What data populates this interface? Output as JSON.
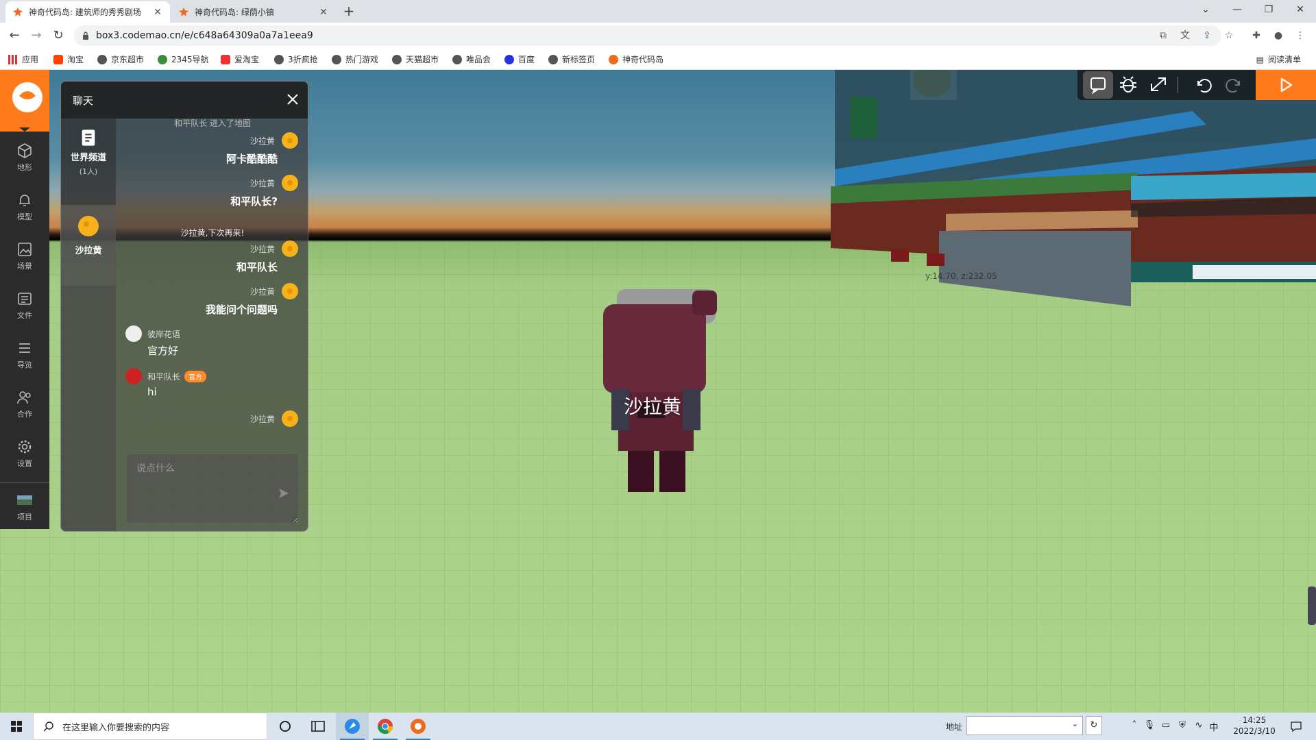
{
  "browser": {
    "tabs": [
      {
        "title": "神奇代码岛: 建筑师的秀秀剧场",
        "close": "✕"
      },
      {
        "title": "神奇代码岛: 绿荫小镇",
        "close": "✕"
      }
    ],
    "new_tab": "+",
    "url": "box3.codemao.cn/e/c648a64309a0a7a1eea9",
    "bookmarks": [
      "应用",
      "淘宝",
      "京东超市",
      "2345导航",
      "爱淘宝",
      "3折疯抢",
      "热门游戏",
      "天猫超市",
      "唯品会",
      "百度",
      "新标签页",
      "神奇代码岛"
    ],
    "reading_list": "阅读清单"
  },
  "sidebar": {
    "items": [
      {
        "label": "地形",
        "icon": "cube-icon"
      },
      {
        "label": "模型",
        "icon": "bell-icon"
      },
      {
        "label": "场景",
        "icon": "image-icon"
      },
      {
        "label": "文件",
        "icon": "file-icon"
      },
      {
        "label": "导览",
        "icon": "list-icon"
      },
      {
        "label": "合作",
        "icon": "users-icon"
      },
      {
        "label": "设置",
        "icon": "gear-icon"
      },
      {
        "label": "项目",
        "icon": "project-thumb"
      }
    ]
  },
  "chat": {
    "title": "聊天",
    "channels": [
      {
        "name": "世界频道",
        "count": "(1人)"
      },
      {
        "name": "沙拉黄"
      }
    ],
    "truncated_top": "和平队长 进入了地图",
    "messages": [
      {
        "author": "沙拉黄",
        "text": "阿卡酷酷酷"
      },
      {
        "author": "沙拉黄",
        "text": "和平队长?"
      },
      {
        "system": "沙拉黄,下次再来!"
      },
      {
        "author": "沙拉黄",
        "text": "和平队长"
      },
      {
        "author": "沙拉黄",
        "text": "我能问个问题吗"
      },
      {
        "author": "彼岸花语",
        "text": "官方好"
      },
      {
        "author": "和平队长",
        "badge": "官方",
        "text": "hi"
      },
      {
        "author": "沙拉黄",
        "text": ""
      }
    ],
    "input_placeholder": "说点什么"
  },
  "game": {
    "player_name": "沙拉黄",
    "coords": "y:14.70, z:232.05"
  },
  "taskbar": {
    "search_placeholder": "在这里输入你要搜索的内容",
    "address_label": "地址",
    "time": "14:25",
    "date": "2022/3/10",
    "ime": "中"
  },
  "colors": {
    "accent": "#ff7a1a",
    "sidebar_bg": "#2b2b2b"
  }
}
